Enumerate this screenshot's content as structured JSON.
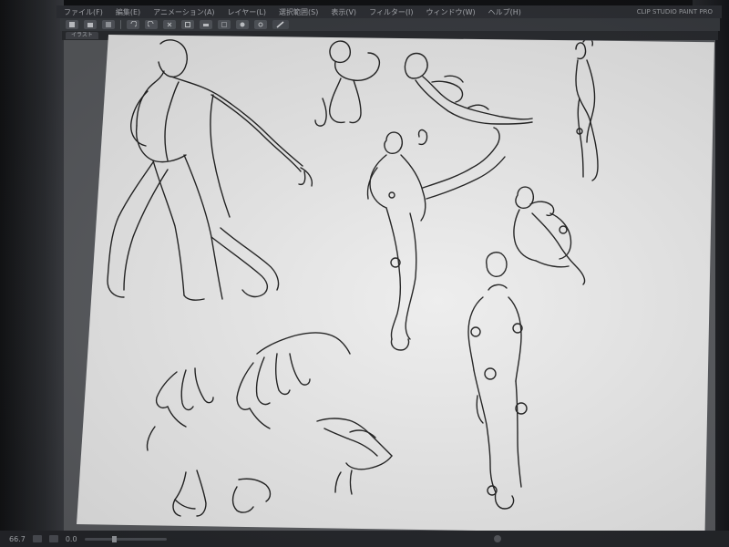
{
  "menu": {
    "items": [
      {
        "label": "ファイル(F)"
      },
      {
        "label": "編集(E)"
      },
      {
        "label": "アニメーション(A)"
      },
      {
        "label": "レイヤー(L)"
      },
      {
        "label": "選択範囲(S)"
      },
      {
        "label": "表示(V)"
      },
      {
        "label": "フィルター(I)"
      },
      {
        "label": "ウィンドウ(W)"
      },
      {
        "label": "ヘルプ(H)"
      }
    ],
    "window_title": "CLIP STUDIO PAINT PRO"
  },
  "toolbar": {
    "icons": [
      "new-file-icon",
      "open-file-icon",
      "save-icon",
      "undo-icon",
      "redo-icon",
      "clear-icon",
      "transform-icon",
      "layer-icon",
      "select-icon",
      "fill-icon",
      "settings-icon",
      "pen-icon"
    ]
  },
  "document": {
    "tab_label": "イラスト"
  },
  "status": {
    "zoom": "66.7",
    "angle": "0.0"
  },
  "colors": {
    "background": "#1a1c1f",
    "menubar": "#2f3136",
    "canvas_paper": "#ededed",
    "sketch_ink": "#222222"
  }
}
